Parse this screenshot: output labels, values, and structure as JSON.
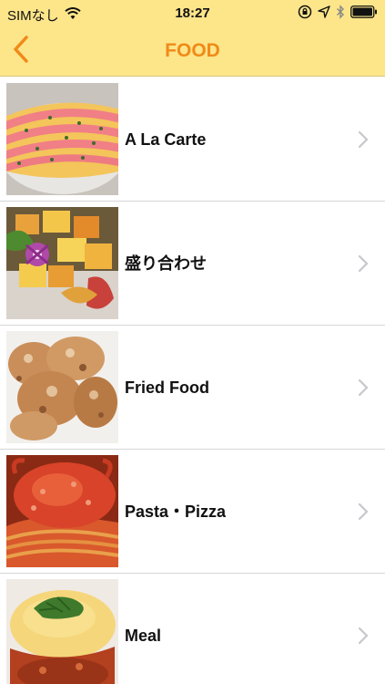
{
  "status_bar": {
    "carrier": "SIMなし",
    "time": "18:27"
  },
  "nav": {
    "title": "FOOD"
  },
  "colors": {
    "bar_background": "#fde58a",
    "accent": "#f08a18",
    "chevron": "#c7c7cc"
  },
  "icons": [
    "wifi-icon",
    "orientation-lock-icon",
    "location-arrow-icon",
    "bluetooth-icon",
    "battery-icon",
    "back-chevron-icon",
    "chevron-right-icon"
  ],
  "menu": {
    "items": [
      {
        "label": "A La Carte"
      },
      {
        "label": "盛り合わせ"
      },
      {
        "label": "Fried Food"
      },
      {
        "label": "Pasta・Pizza"
      },
      {
        "label": "Meal"
      }
    ]
  }
}
